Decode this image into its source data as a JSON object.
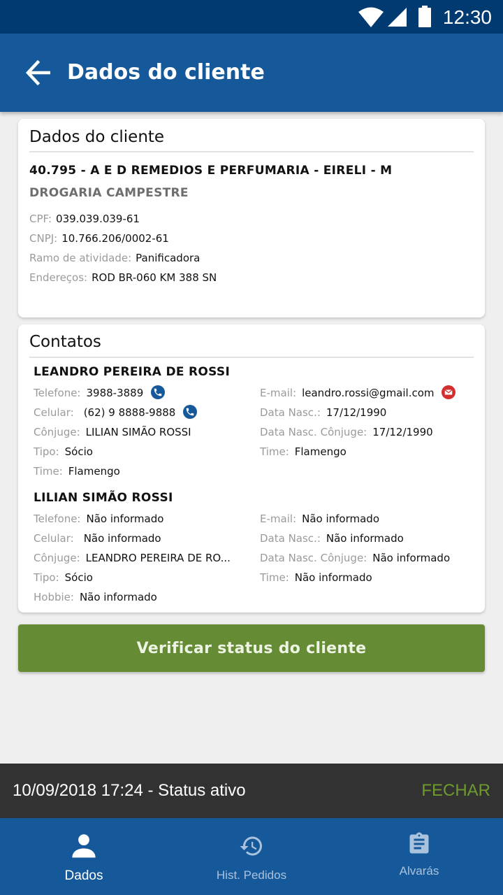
{
  "status_bar": {
    "time": "12:30"
  },
  "app_bar": {
    "title": "Dados do cliente"
  },
  "client_card": {
    "title": "Dados do cliente",
    "company_name": "40.795 - A E D REMEDIOS E PERFUMARIA - EIRELI - M",
    "trade_name": "DROGARIA CAMPESTRE",
    "fields": [
      {
        "label": "CPF:",
        "value": "039.039.039-61"
      },
      {
        "label": "CNPJ:",
        "value": "10.766.206/0002-61"
      },
      {
        "label": "Ramo de atividade:",
        "value": "Panificadora"
      },
      {
        "label": "Endereços:",
        "value": "ROD BR-060 KM 388 SN"
      }
    ]
  },
  "contacts_card": {
    "title": "Contatos",
    "contacts": [
      {
        "name": "LEANDRO PEREIRA DE ROSSI",
        "telefone": {
          "label": "Telefone:",
          "value": "3988-3889"
        },
        "celular": {
          "label": "Celular:",
          "value": "(62) 9 8888-9888"
        },
        "conjuge": {
          "label": "Cônjuge:",
          "value": "LILIAN SIMÃO ROSSI"
        },
        "tipo": {
          "label": "Tipo:",
          "value": "Sócio"
        },
        "extra": {
          "label": "Time:",
          "value": "Flamengo"
        },
        "email": {
          "label": "E-mail:",
          "value": "leandro.rossi@gmail.com"
        },
        "data_nasc": {
          "label": "Data Nasc.:",
          "value": "17/12/1990"
        },
        "data_nasc_conjuge": {
          "label": "Data Nasc. Cônjuge:",
          "value": "17/12/1990"
        },
        "time": {
          "label": "Time:",
          "value": "Flamengo"
        }
      },
      {
        "name": "LILIAN SIMÃO ROSSI",
        "telefone": {
          "label": "Telefone:",
          "value": "Não informado"
        },
        "celular": {
          "label": "Celular:",
          "value": "Não informado"
        },
        "conjuge": {
          "label": "Cônjuge:",
          "value": "LEANDRO PEREIRA DE RO..."
        },
        "tipo": {
          "label": "Tipo:",
          "value": "Sócio"
        },
        "extra": {
          "label": "Hobbie:",
          "value": "Não informado"
        },
        "email": {
          "label": "E-mail:",
          "value": "Não informado"
        },
        "data_nasc": {
          "label": "Data Nasc.:",
          "value": "Não informado"
        },
        "data_nasc_conjuge": {
          "label": "Data Nasc. Cônjuge:",
          "value": "Não informado"
        },
        "time": {
          "label": "Time:",
          "value": "Não informado"
        }
      }
    ]
  },
  "action_button": {
    "label": "Verificar status do cliente"
  },
  "snackbar": {
    "message": "10/09/2018 17:24 - Status ativo",
    "action": "FECHAR"
  },
  "bottom_nav": {
    "items": [
      {
        "label": "Dados",
        "icon": "person-icon",
        "active": true
      },
      {
        "label": "Hist. Pedidos",
        "icon": "history-icon",
        "active": false
      },
      {
        "label": "Alvarás",
        "icon": "clipboard-icon",
        "active": false
      }
    ]
  },
  "colors": {
    "status_bar": "#003a70",
    "primary": "#16599a",
    "action_green": "#668b35",
    "snackbar_action": "#6f9a2c",
    "email_icon": "#d32f2f"
  }
}
